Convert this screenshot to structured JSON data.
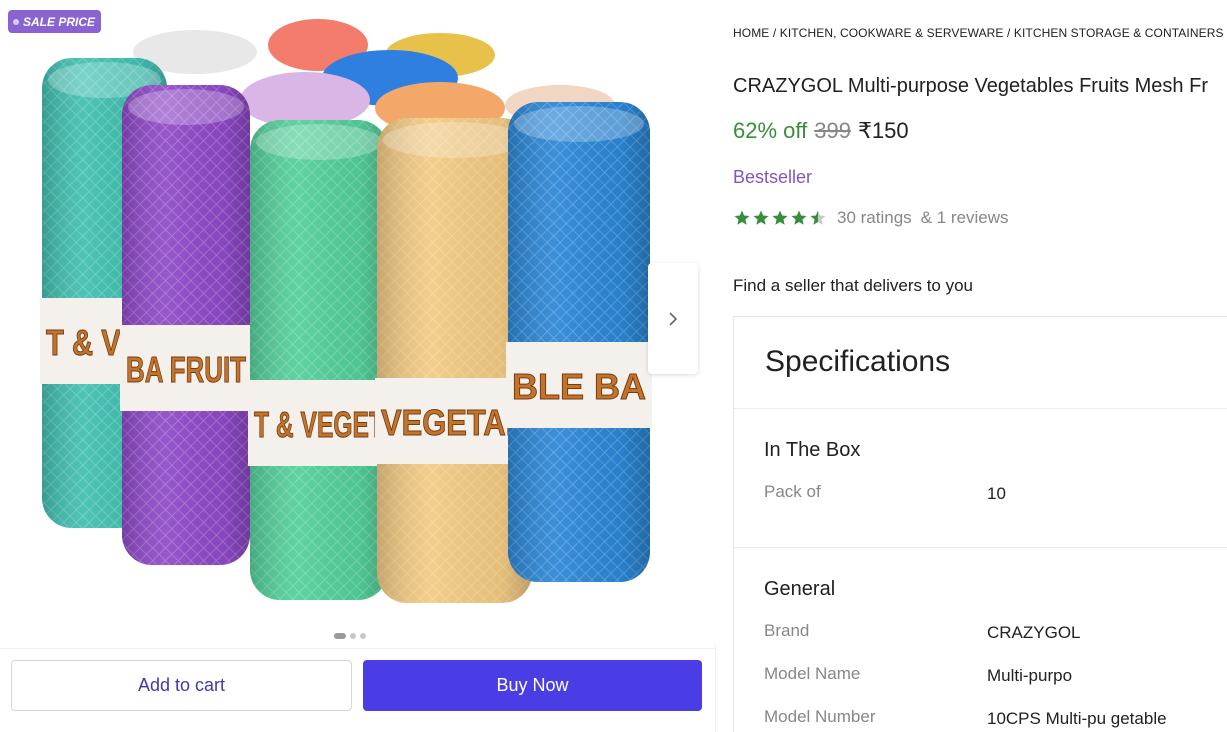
{
  "gallery": {
    "badge_label": "SALE PRICE",
    "next_icon": "chevron-right-icon",
    "pager_count": 3,
    "pager_active": 1,
    "product_colors": [
      "#3fbfb0",
      "#8e48c8",
      "#52cf9a",
      "#f2c981",
      "#2a86d6"
    ],
    "band_text": [
      "T & VEG",
      "BA",
      "FRUIT",
      "T & VEGET",
      "VEGETAB",
      "BLE BA"
    ]
  },
  "actions": {
    "add_to_cart_label": "Add to cart",
    "buy_now_label": "Buy Now"
  },
  "breadcrumb": [
    "HOME",
    "KITCHEN, COOKWARE & SERVEWARE",
    "KITCHEN STORAGE & CONTAINERS"
  ],
  "breadcrumb_separator": " / ",
  "product": {
    "title": "CRAZYGOL Multi-purpose Vegetables Fruits Mesh Fr",
    "discount": "62% off",
    "mrp": "399",
    "price": "₹150",
    "bestseller_label": "Bestseller",
    "rating": 4.5,
    "ratings_text": "30 ratings",
    "reviews_text": "& 1 reviews",
    "star_color": "#388e3c"
  },
  "seller_finder_text": "Find a seller that delivers to you",
  "specifications": {
    "heading": "Specifications",
    "sections": [
      {
        "title": "In The Box",
        "rows": [
          {
            "key": "Pack of",
            "value": "10"
          }
        ]
      },
      {
        "title": "General",
        "rows": [
          {
            "key": "Brand",
            "value": "CRAZYGOL"
          },
          {
            "key": "Model Name",
            "value": "Multi-purpo"
          },
          {
            "key": "Model Number",
            "value": "10CPS Multi-pu        getable"
          }
        ]
      }
    ]
  },
  "colors": {
    "accent": "#4b3de6",
    "sale_badge": "#8a63d2",
    "discount_green": "#388e3c",
    "bestseller_purple": "#7e57c2"
  }
}
